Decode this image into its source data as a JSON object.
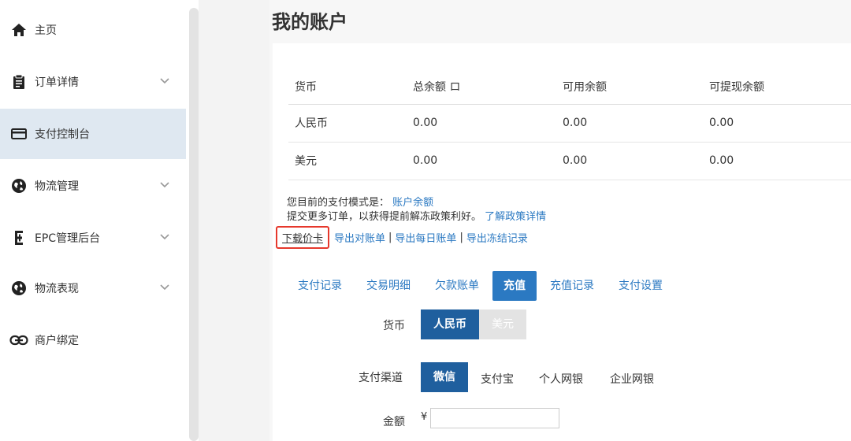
{
  "sidebar": {
    "items": [
      {
        "label": "主页",
        "icon": "home-icon"
      },
      {
        "label": "订单详情",
        "icon": "clipboard-icon"
      },
      {
        "label": "支付控制台",
        "icon": "credit-card-icon"
      },
      {
        "label": "物流管理",
        "icon": "globe-icon"
      },
      {
        "label": "EPC管理后台",
        "icon": "e-icon"
      },
      {
        "label": "物流表现",
        "icon": "globe-icon"
      },
      {
        "label": "商户绑定",
        "icon": "link-icon"
      }
    ]
  },
  "page": {
    "title": "我的账户"
  },
  "table": {
    "headers": [
      "货币",
      "总余额 ロ",
      "可用余额",
      "可提现余额"
    ],
    "rows": [
      [
        "人民币",
        "0.00",
        "0.00",
        "0.00"
      ],
      [
        "美元",
        "0.00",
        "0.00",
        "0.00"
      ]
    ]
  },
  "info": {
    "mode_prefix": "您目前的支付模式是：",
    "mode_value": "账户余额",
    "policy_text": "提交更多订单，以获得提前解冻政策利好。",
    "policy_link": "了解政策详情"
  },
  "links": {
    "download_card": "下载价卡",
    "export_reconciliation": "导出对账单",
    "export_daily": "导出每日账单",
    "export_frozen": "导出冻结记录",
    "separator": "|"
  },
  "tabs": [
    "支付记录",
    "交易明细",
    "欠款账单",
    "充值",
    "充值记录",
    "支付设置"
  ],
  "recharge": {
    "currency_label": "货币",
    "currency_options": [
      "人民币",
      "美元"
    ],
    "channel_label": "支付渠道",
    "channel_options": [
      "微信",
      "支付宝",
      "个人网银",
      "企业网银"
    ],
    "amount_label": "金额",
    "amount_symbol": "¥",
    "amount_value": ""
  },
  "colors": {
    "accent": "#2b79c2",
    "active_dark": "#1f5f9e",
    "highlight_border": "#e6382c",
    "sidebar_active": "#dfe8f1"
  }
}
